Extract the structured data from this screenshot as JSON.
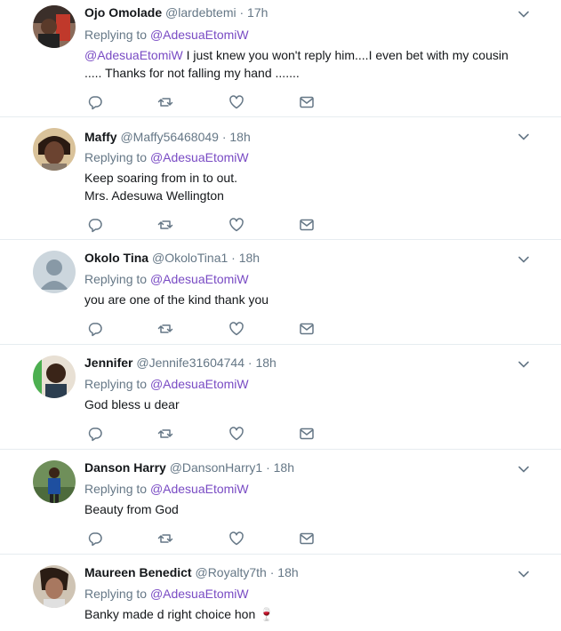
{
  "reply_prefix": "Replying to",
  "reply_target": "@AdesuaEtomiW",
  "dot": "·",
  "icons": {
    "reply": "reply-icon",
    "retweet": "retweet-icon",
    "like": "heart-icon",
    "dm": "envelope-icon",
    "caret": "chevron-down-icon"
  },
  "colors": {
    "mention": "#794bc4",
    "secondary": "#657786",
    "icon": "#657786"
  },
  "tweets": [
    {
      "name": "Ojo Omolade",
      "handle": "@lardebtemi",
      "time": "17h",
      "mention": "@AdesuaEtomiW",
      "text": " I just knew you won't reply him....I even bet with my cousin ..... Thanks for not falling my hand ......."
    },
    {
      "name": "Maffy",
      "handle": "@Maffy56468049",
      "time": "18h",
      "text": "Keep soaring from in to out.\n Mrs. Adesuwa Wellington"
    },
    {
      "name": "Okolo Tina",
      "handle": "@OkoloTina1",
      "time": "18h",
      "text": "you are one of the kind thank you"
    },
    {
      "name": "Jennifer",
      "handle": "@Jennife31604744",
      "time": "18h",
      "text": "God bless u dear"
    },
    {
      "name": "Danson Harry",
      "handle": "@DansonHarry1",
      "time": "18h",
      "text": "Beauty from God"
    },
    {
      "name": "Maureen Benedict",
      "handle": "@Royalty7th",
      "time": "18h",
      "text": "Banky made d right choice hon 🍷"
    }
  ]
}
